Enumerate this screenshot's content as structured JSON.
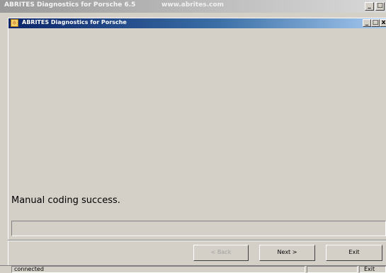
{
  "outer_window": {
    "title": "ABRITES Diagnostics for Porsche 6.5",
    "url": "www.abrites.com",
    "min_label": "_",
    "max_label": "□"
  },
  "inner_window": {
    "title": "ABRITES Diagnostics for Porsche",
    "icon_glyph": "☼",
    "min_label": "_",
    "max_label": "□",
    "close_label": "x"
  },
  "main": {
    "message": "Manual coding success."
  },
  "buttons": {
    "back": "< Back",
    "next": "Next >",
    "exit": "Exit"
  },
  "statusbar": {
    "connection": "connected",
    "exit": "Exit"
  }
}
